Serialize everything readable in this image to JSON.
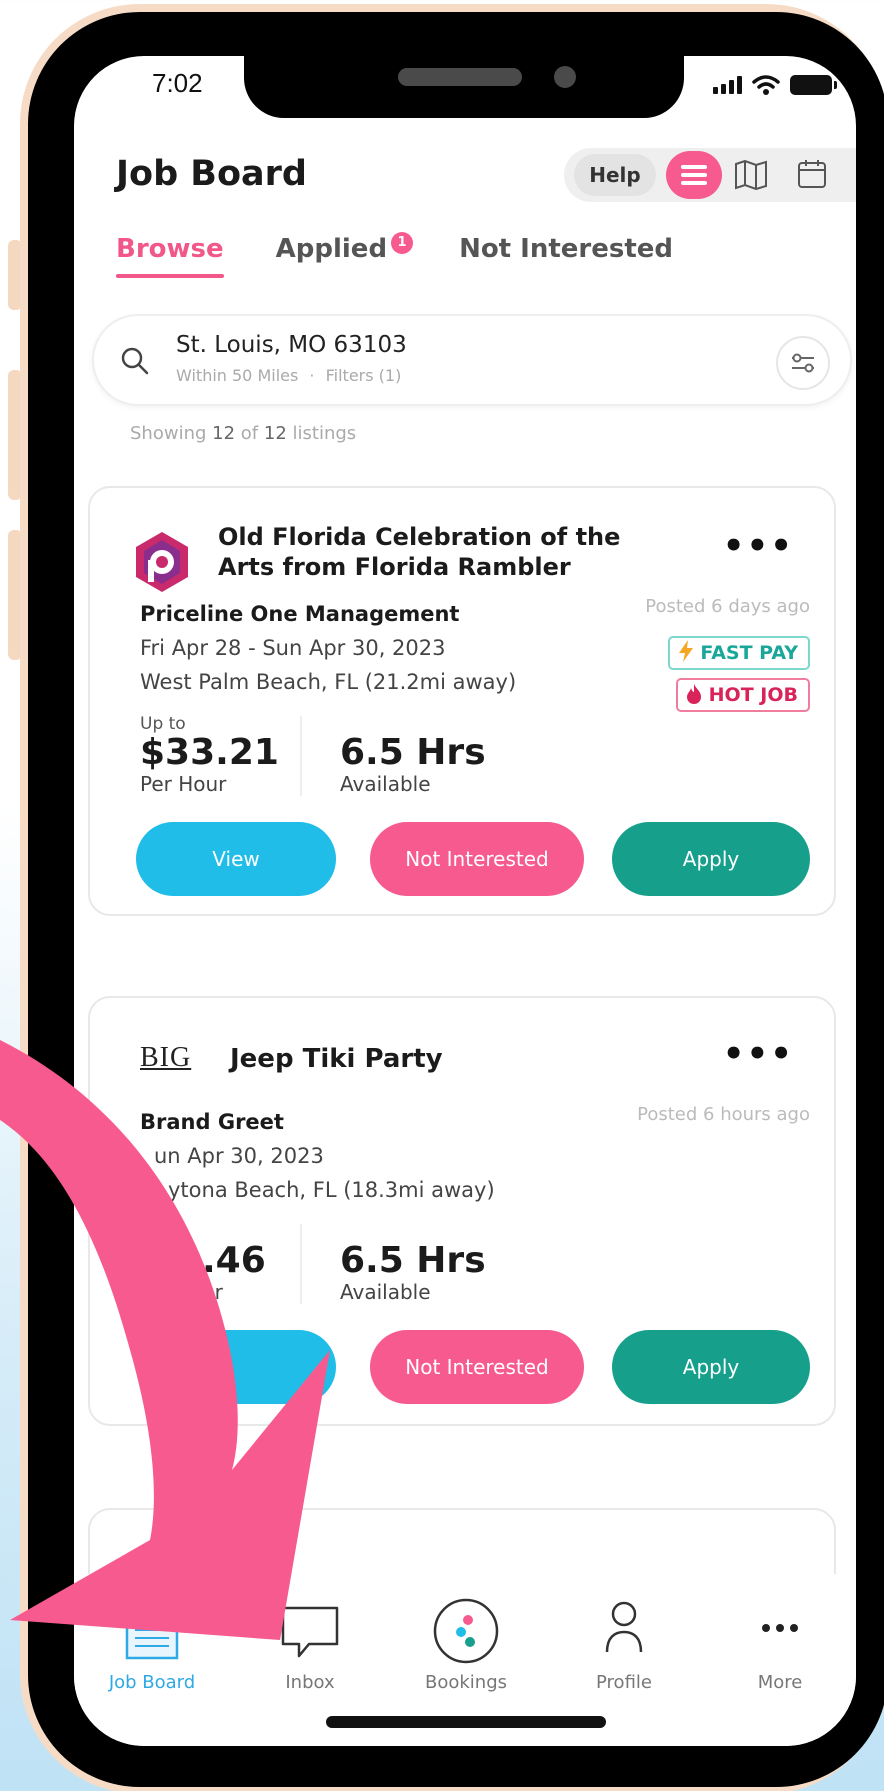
{
  "status_bar": {
    "time": "7:02"
  },
  "header": {
    "title": "Job Board",
    "help_label": "Help",
    "view_icons": [
      "list-icon",
      "map-icon",
      "calendar-icon"
    ]
  },
  "tabs": [
    {
      "label": "Browse",
      "active": true
    },
    {
      "label": "Applied",
      "badge": "1"
    },
    {
      "label": "Not Interested"
    }
  ],
  "search": {
    "location": "St. Louis, MO 63103",
    "radius": "Within 50 Miles",
    "separator": "·",
    "filters": "Filters (1)"
  },
  "listing_summary": {
    "prefix": "Showing",
    "shown": "12",
    "of": "of",
    "total": "12",
    "suffix": "listings"
  },
  "jobs": [
    {
      "title_line1": "Old Florida Celebration of the",
      "title_line2": "Arts from Florida Rambler",
      "company": "Priceline One Management",
      "posted": "Posted 6 days ago",
      "dates": "Fri Apr 28 - Sun Apr 30, 2023",
      "location": "West Palm Beach, FL (21.2mi away)",
      "tags": [
        "FAST PAY",
        "HOT JOB"
      ],
      "pay_prefix": "Up to",
      "pay": "$33.21",
      "pay_unit": "Per Hour",
      "hours": "6.5 Hrs",
      "hours_unit": "Available",
      "more_label": "•••",
      "buttons": {
        "view": "View",
        "not_interested": "Not Interested",
        "apply": "Apply"
      }
    },
    {
      "title_line1": "Jeep Tiki Party",
      "logo_text": "BIG",
      "company": "Brand Greet",
      "posted": "Posted 6 hours ago",
      "dates": "un Apr 30, 2023",
      "location": "ytona Beach, FL (18.3mi away)",
      "pay": ".46",
      "pay_unit": "ur",
      "hours": "6.5 Hrs",
      "hours_unit": "Available",
      "more_label": "•••",
      "buttons": {
        "not_interested": "Not Interested",
        "apply": "Apply"
      }
    }
  ],
  "bottom_nav": [
    {
      "label": "Job Board",
      "icon": "job-board-icon",
      "active": true
    },
    {
      "label": "Inbox",
      "icon": "chat-bubble-icon"
    },
    {
      "label": "Bookings",
      "icon": "bookings-icon"
    },
    {
      "label": "Profile",
      "icon": "person-icon"
    },
    {
      "label": "More",
      "icon": "more-dots-icon"
    }
  ],
  "colors": {
    "accent_pink": "#f75a8e",
    "view_blue": "#1fbde8",
    "apply_green": "#16a08c",
    "fast_pay_teal": "#1aa79a",
    "hot_job_red": "#d8245b",
    "nav_active_blue": "#2ea9e4"
  }
}
